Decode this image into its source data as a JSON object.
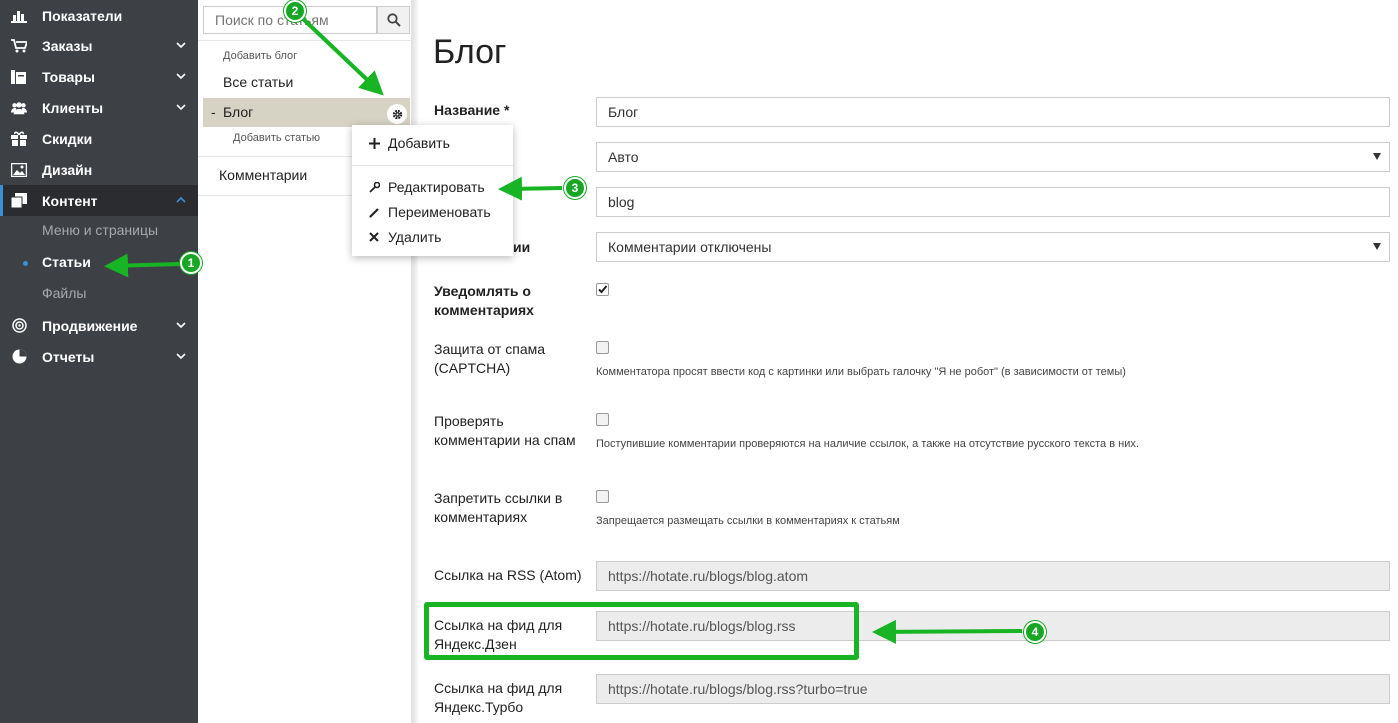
{
  "nav": {
    "items": [
      {
        "label": "Показатели",
        "icon": "bar-chart-icon"
      },
      {
        "label": "Заказы",
        "icon": "cart-icon"
      },
      {
        "label": "Товары",
        "icon": "box-icon"
      },
      {
        "label": "Клиенты",
        "icon": "users-icon"
      },
      {
        "label": "Скидки",
        "icon": "gift-icon"
      },
      {
        "label": "Дизайн",
        "icon": "picture-icon"
      },
      {
        "label": "Контент",
        "icon": "copy-icon"
      },
      {
        "label": "Продвижение",
        "icon": "target-icon"
      },
      {
        "label": "Отчеты",
        "icon": "pie-icon"
      }
    ],
    "sub_items": [
      "Меню и страницы",
      "Статьи",
      "Файлы"
    ]
  },
  "tree": {
    "search_placeholder": "Поиск по статьям",
    "add_blog": "Добавить блог",
    "all_articles": "Все статьи",
    "blog_prefix": "-",
    "blog": "Блог",
    "add_article": "Добавить статью",
    "comments": "Комментарии"
  },
  "context_menu": {
    "add": "Добавить",
    "edit": "Редактировать",
    "rename": "Переименовать",
    "delete": "Удалить"
  },
  "form": {
    "title": "Блог",
    "name_label": "Название *",
    "name_value": "Блог",
    "mode_value": "Авто",
    "slug_value": "blog",
    "comments_label_fragment": "ии",
    "comments_value": "Комментарии отключены",
    "notify_label": "Уведомлять о комментариях",
    "notify_checked": true,
    "captcha_label": "Защита от спама (CAPTCHA)",
    "captcha_hint": "Комментатора просят ввести код с картинки или выбрать галочку \"Я не робот\" (в зависимости от темы)",
    "spamcheck_label": "Проверять комментарии на спам",
    "spamcheck_hint": "Поступившие комментарии проверяются на наличие ссылок, а также на отсутствие русского текста в них.",
    "nolinks_label": "Запретить ссылки в комментариях",
    "nolinks_hint": "Запрещается размещать ссылки в комментариях к статьям",
    "rss_label": "Ссылка на RSS (Atom)",
    "rss_value": "https://hotate.ru/blogs/blog.atom",
    "zen_label": "Ссылка на фид для Яндекс.Дзен",
    "zen_value": "https://hotate.ru/blogs/blog.rss",
    "turbo_label": "Ссылка на фид для Яндекс.Турбо",
    "turbo_value": "https://hotate.ru/blogs/blog.rss?turbo=true"
  },
  "annotations": {
    "b1": "1",
    "b2": "2",
    "b3": "3",
    "b4": "4"
  },
  "colors": {
    "nav_bg": "#3d4045",
    "nav_active": "#2a2c30",
    "accent": "#3b8fd4",
    "annotation_green": "#17a725",
    "tree_selected": "#d6d2c4"
  }
}
